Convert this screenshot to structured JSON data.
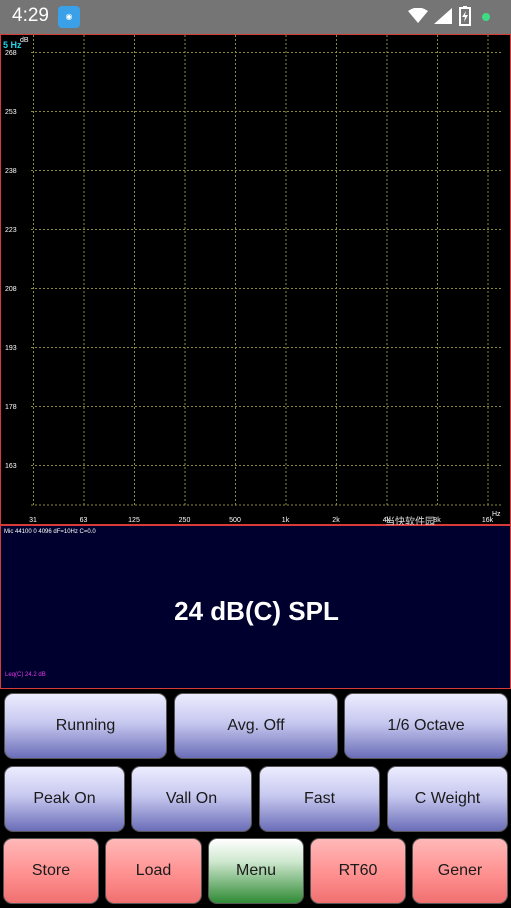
{
  "status_bar": {
    "time": "4:29",
    "app_icon": "app-icon",
    "icons": [
      "wifi-icon",
      "signal-icon",
      "battery-charging-icon",
      "notification-dot"
    ]
  },
  "graph": {
    "hz_readout": "5 Hz",
    "y_unit": "dB",
    "x_unit": "Hz",
    "y_ticks": [
      "268",
      "253",
      "238",
      "223",
      "208",
      "193",
      "178",
      "163"
    ],
    "x_ticks": [
      "31",
      "63",
      "125",
      "250",
      "500",
      "1k",
      "2k",
      "4k",
      "8k",
      "16k"
    ],
    "watermark": "当快软件园",
    "colors": {
      "grid": "#8a8a3a",
      "border": "#d83a3a",
      "hz_readout": "#22d4e8"
    }
  },
  "spl_panel": {
    "mic_info": "Mic 44100 0 4096 dF=10Hz C=0.0",
    "spl_value": "24 dB(C) SPL",
    "leq": "Leq(C)  24.2 dB"
  },
  "controls": {
    "row1": [
      "Running",
      "Avg. Off",
      "1/6 Octave"
    ],
    "row2": [
      "Peak On",
      "Vall On",
      "Fast",
      "C Weight"
    ],
    "row3": [
      "Store",
      "Load",
      "Menu",
      "RT60",
      "Gener"
    ]
  }
}
